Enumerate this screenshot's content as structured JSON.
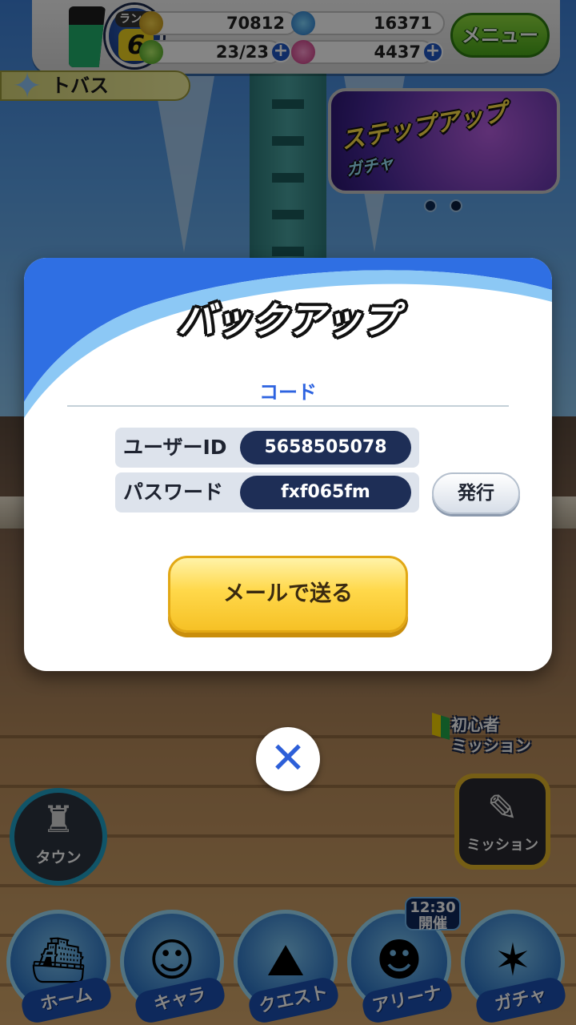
{
  "hud": {
    "rank_label": "ランク",
    "rank_value": "6",
    "stamina_fill": 0.7,
    "coins": "70812",
    "gems": "16371",
    "energy": "23/23",
    "orbs": "4437",
    "menu_label": "メニュー",
    "player_name": "トバス"
  },
  "banner": {
    "line1": "ステップアップ",
    "line2": "ガチャ"
  },
  "modal": {
    "title": "バックアップ",
    "section": "コード",
    "user_id_label": "ユーザーID",
    "user_id_value": "5658505078",
    "password_label": "パスワード",
    "password_value": "fxf065fm",
    "issue_label": "発行",
    "send_mail_label": "メールで送る"
  },
  "side": {
    "beginner_line1": "初心者",
    "beginner_line2": "ミッション",
    "mission_label": "ミッション",
    "town_label": "タウン"
  },
  "nav": {
    "home": "ホーム",
    "chara": "キャラ",
    "quest": "クエスト",
    "arena": "アリーナ",
    "gacha": "ガチャ",
    "event_time": "12:30",
    "event_status": "開催"
  },
  "colors": {
    "accent_blue": "#2d63e0",
    "button_yellow": "#ffd84a",
    "menu_green": "#4aa81a"
  }
}
